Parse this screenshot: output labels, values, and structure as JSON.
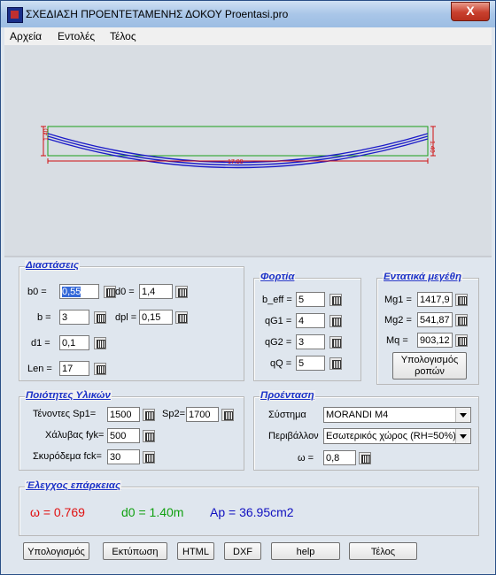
{
  "window": {
    "title": "ΣΧΕΔΙΑΣΗ ΠΡΟΕΝΤΕΤΑΜΕΝΗΣ ΔΟΚΟΥ  Proentasi.pro",
    "close_symbol": "X"
  },
  "menu": [
    "Αρχεία",
    "Εντολές",
    "Τέλος"
  ],
  "drawing": {
    "length_label": "17.00",
    "left_dim": "1.40",
    "right_dim": "1.40",
    "colors": {
      "beam": "#1aa01a",
      "tendon": "#1c1cc8",
      "dims": "#d01010"
    }
  },
  "dimensions": {
    "title": "Διαστάσεις",
    "b0_label": "b0 =",
    "b0": "0,55",
    "d0_label": "d0 =",
    "d0": "1,4",
    "b_label": "b =",
    "b": "3",
    "dpl_label": "dpl =",
    "dpl": "0,15",
    "d1_label": "d1 =",
    "d1": "0,1",
    "len_label": "Len =",
    "len": "17"
  },
  "loads": {
    "title": "Φορτία",
    "beff_label": "b_eff =",
    "beff": "5",
    "qg1_label": "qG1 =",
    "qg1": "4",
    "qg2_label": "qG2 =",
    "qg2": "3",
    "qq_label": "qQ =",
    "qq": "5"
  },
  "forces": {
    "title": "Εντατικά μεγέθη",
    "mg1_label": "Mg1 =",
    "mg1": "1417,9",
    "mg2_label": "Mg2 =",
    "mg2": "541,87",
    "mq_label": "Mq =",
    "mq": "903,12",
    "button_line1": "Υπολογισμός",
    "button_line2": "ροπών"
  },
  "materials": {
    "title": "Ποιότητες Υλικών",
    "tendons_label": "Τένοντες  Sp1=",
    "sp1": "1500",
    "sp2_label": "Sp2=",
    "sp2": "1700",
    "steel_label": "Χάλυβας fyk=",
    "fyk": "500",
    "concrete_label": "Σκυρόδεμα fck=",
    "fck": "30"
  },
  "prestress": {
    "title": "Προένταση",
    "system_label": "Σύστημα",
    "system": "MORANDI M4",
    "env_label": "Περιβάλλον",
    "env": "Εσωτερικός χώρος (RH=50%)",
    "omega_label": "ω =",
    "omega": "0,8"
  },
  "check": {
    "title": "Έλεγχος επάρκειας",
    "omega_result": "ω = 0.769",
    "d0_result": "d0 = 1.40m",
    "ap_result": "Ap = 36.95cm2",
    "colors": {
      "omega": "#e01010",
      "d0": "#10a010",
      "ap": "#1010c0"
    }
  },
  "buttons": {
    "calc": "Υπολογισμός",
    "print": "Εκτύπωση",
    "html": "HTML",
    "dxf": "DXF",
    "help": "help",
    "exit": "Τέλος"
  }
}
